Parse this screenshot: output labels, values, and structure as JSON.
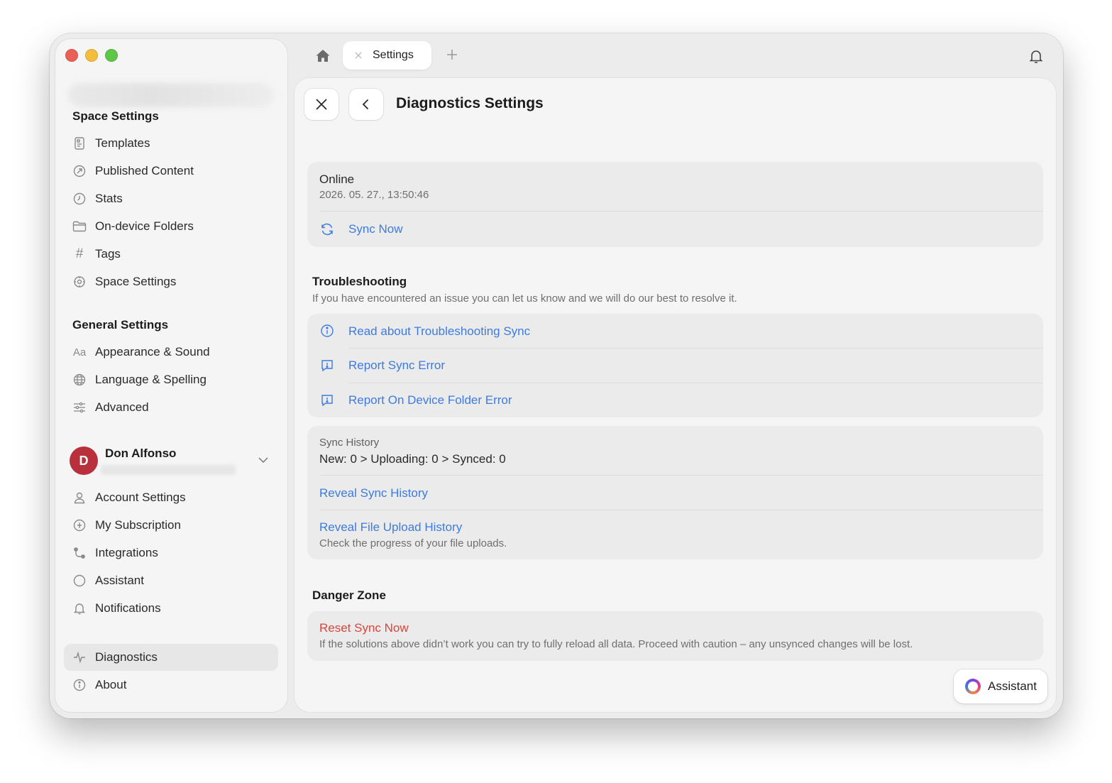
{
  "sidebar": {
    "space_title": "Space Settings",
    "space_items": [
      {
        "label": "Templates",
        "icon": "template-icon"
      },
      {
        "label": "Published Content",
        "icon": "published-icon"
      },
      {
        "label": "Stats",
        "icon": "clock-icon"
      },
      {
        "label": "On-device Folders",
        "icon": "folder-icon"
      },
      {
        "label": "Tags",
        "icon": "hash-icon"
      },
      {
        "label": "Space Settings",
        "icon": "gear-icon"
      }
    ],
    "general_title": "General Settings",
    "general_items": [
      {
        "label": "Appearance & Sound",
        "icon": "text-aa-icon",
        "glyph": "Aa"
      },
      {
        "label": "Language & Spelling",
        "icon": "globe-icon"
      },
      {
        "label": "Advanced",
        "icon": "sliders-icon"
      }
    ],
    "profile": {
      "initial": "D",
      "name": "Don Alfonso"
    },
    "account_items": [
      {
        "label": "Account Settings",
        "icon": "person-icon"
      },
      {
        "label": "My Subscription",
        "icon": "subscription-icon"
      },
      {
        "label": "Integrations",
        "icon": "integrations-icon"
      },
      {
        "label": "Assistant",
        "icon": "circle-icon"
      },
      {
        "label": "Notifications",
        "icon": "bell-icon"
      }
    ],
    "bottom_items": [
      {
        "label": "Diagnostics",
        "icon": "pulse-icon",
        "active": true
      },
      {
        "label": "About",
        "icon": "info-icon"
      }
    ]
  },
  "tabbar": {
    "tab_label": "Settings"
  },
  "main": {
    "title": "Diagnostics Settings",
    "status": {
      "state": "Online",
      "timestamp": "2026. 05. 27., 13:50:46",
      "sync_now": "Sync Now"
    },
    "troubleshooting": {
      "title": "Troubleshooting",
      "subtitle": "If you have encountered an issue you can let us know and we will do our best to resolve it.",
      "links": [
        "Read about Troubleshooting Sync",
        "Report Sync Error",
        "Report On Device Folder Error"
      ]
    },
    "history": {
      "label": "Sync History",
      "value": "New: 0 > Uploading: 0 > Synced: 0",
      "reveal_sync": "Reveal Sync History",
      "reveal_upload": "Reveal File Upload History",
      "upload_desc": "Check the progress of your file uploads."
    },
    "danger": {
      "title": "Danger Zone",
      "reset": "Reset Sync Now",
      "reset_desc": "If the solutions above didn’t work you can try to fully reload all data. Proceed with caution – any unsynced changes will be lost."
    },
    "assistant_button": "Assistant"
  },
  "colors": {
    "accent": "#3d7be0",
    "danger": "#d9453b",
    "avatar": "#b8303c"
  }
}
